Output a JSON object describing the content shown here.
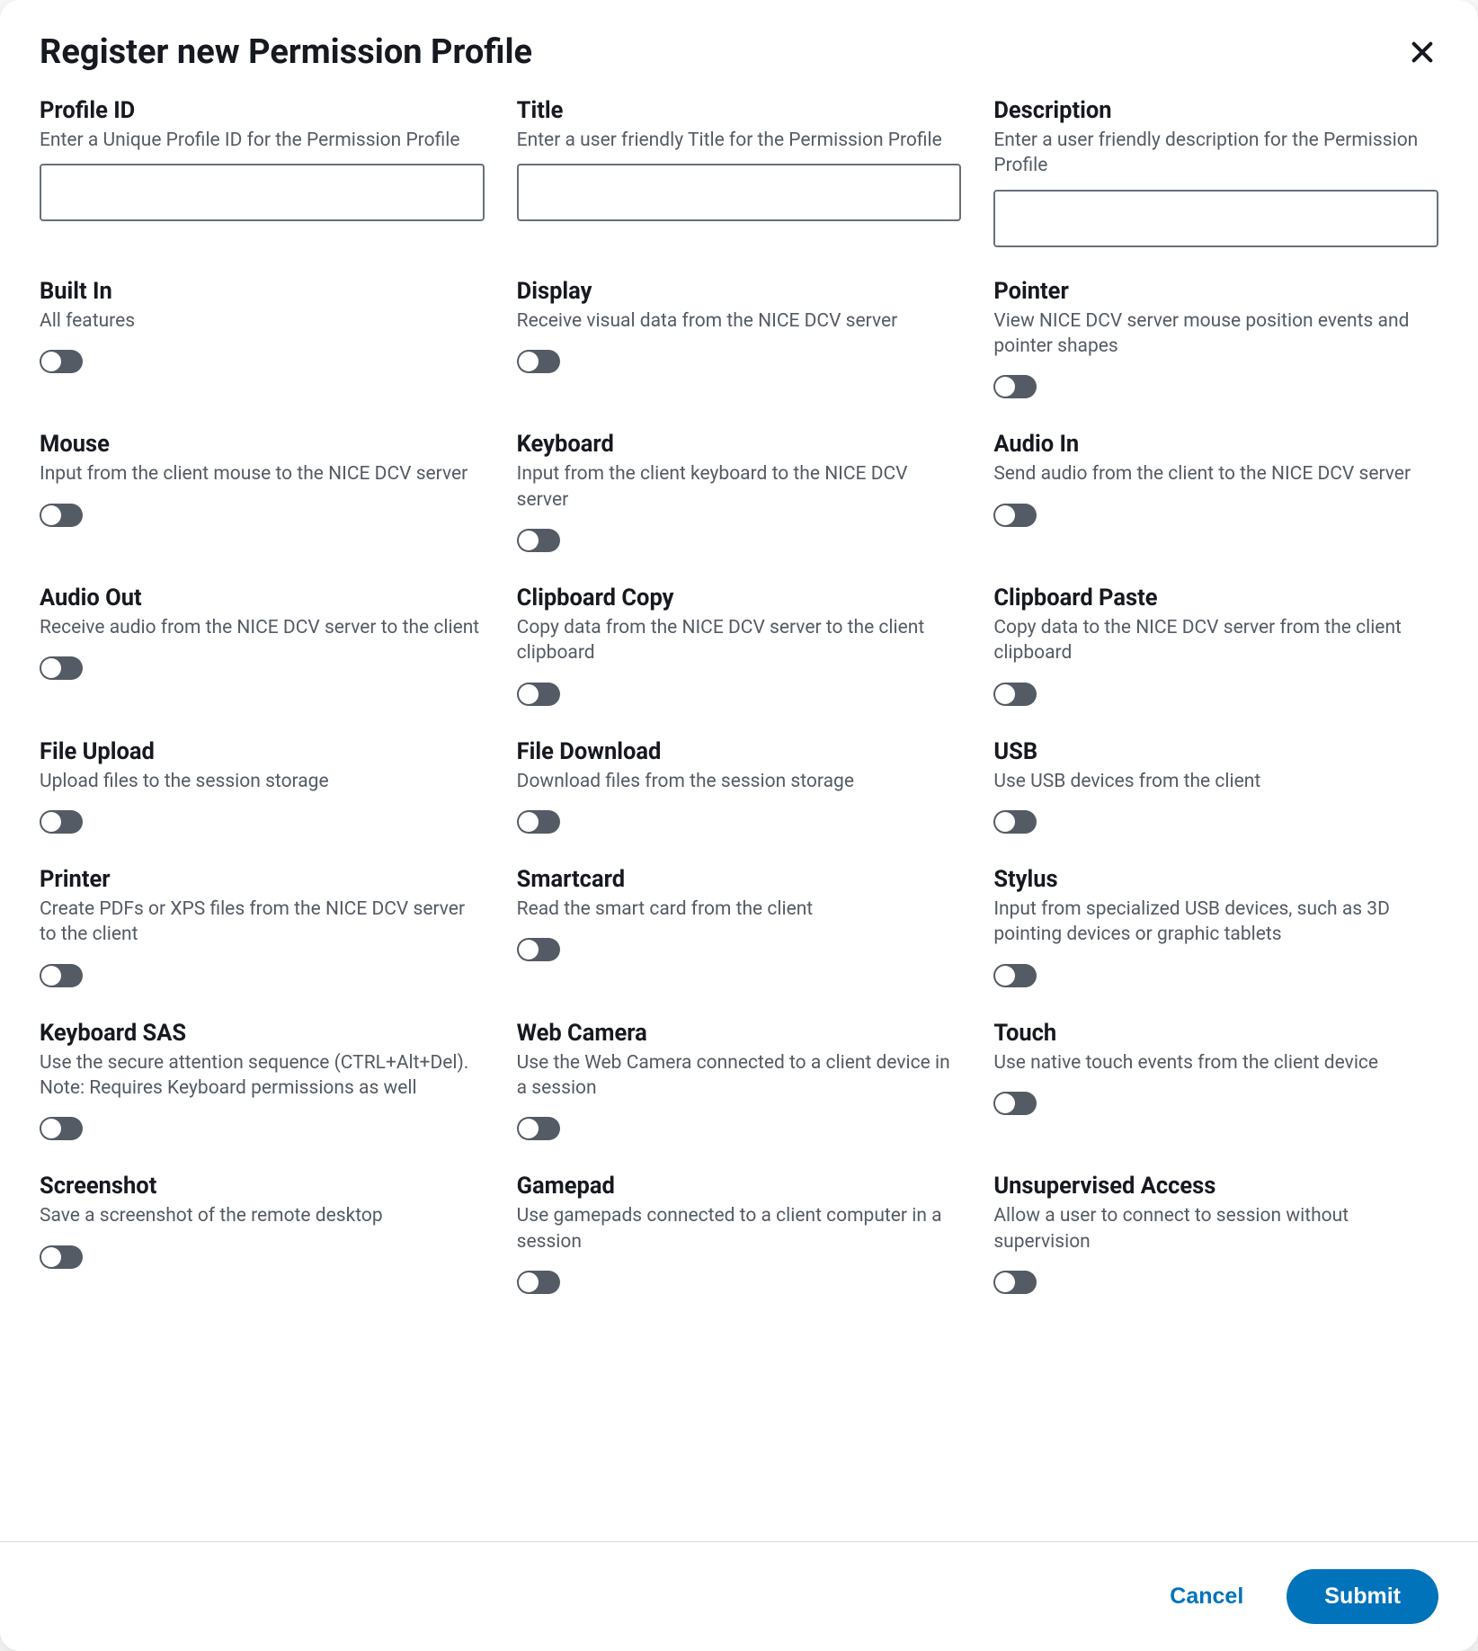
{
  "dialog": {
    "title": "Register new Permission Profile",
    "cancel_label": "Cancel",
    "submit_label": "Submit"
  },
  "text_fields": [
    {
      "key": "profile-id",
      "label": "Profile ID",
      "help": "Enter a Unique Profile ID for the Permission Profile",
      "value": ""
    },
    {
      "key": "title",
      "label": "Title",
      "help": "Enter a user friendly Title for the Permission Profile",
      "value": ""
    },
    {
      "key": "description",
      "label": "Description",
      "help": "Enter a user friendly description for the Permission Profile",
      "value": ""
    }
  ],
  "features": [
    {
      "key": "built-in",
      "label": "Built In",
      "help": "All features",
      "value": false
    },
    {
      "key": "display",
      "label": "Display",
      "help": "Receive visual data from the NICE DCV server",
      "value": false
    },
    {
      "key": "pointer",
      "label": "Pointer",
      "help": "View NICE DCV server mouse position events and pointer shapes",
      "value": false
    },
    {
      "key": "mouse",
      "label": "Mouse",
      "help": "Input from the client mouse to the NICE DCV server",
      "value": false
    },
    {
      "key": "keyboard",
      "label": "Keyboard",
      "help": "Input from the client keyboard to the NICE DCV server",
      "value": false
    },
    {
      "key": "audio-in",
      "label": "Audio In",
      "help": "Send audio from the client to the NICE DCV server",
      "value": false
    },
    {
      "key": "audio-out",
      "label": "Audio Out",
      "help": "Receive audio from the NICE DCV server to the client",
      "value": false
    },
    {
      "key": "clipboard-copy",
      "label": "Clipboard Copy",
      "help": "Copy data from the NICE DCV server to the client clipboard",
      "value": false
    },
    {
      "key": "clipboard-paste",
      "label": "Clipboard Paste",
      "help": "Copy data to the NICE DCV server from the client clipboard",
      "value": false
    },
    {
      "key": "file-upload",
      "label": "File Upload",
      "help": "Upload files to the session storage",
      "value": false
    },
    {
      "key": "file-download",
      "label": "File Download",
      "help": "Download files from the session storage",
      "value": false
    },
    {
      "key": "usb",
      "label": "USB",
      "help": "Use USB devices from the client",
      "value": false
    },
    {
      "key": "printer",
      "label": "Printer",
      "help": "Create PDFs or XPS files from the NICE DCV server to the client",
      "value": false
    },
    {
      "key": "smartcard",
      "label": "Smartcard",
      "help": "Read the smart card from the client",
      "value": false
    },
    {
      "key": "stylus",
      "label": "Stylus",
      "help": "Input from specialized USB devices, such as 3D pointing devices or graphic tablets",
      "value": false
    },
    {
      "key": "keyboard-sas",
      "label": "Keyboard SAS",
      "help": "Use the secure attention sequence (CTRL+Alt+Del). Note: Requires Keyboard permissions as well",
      "value": false
    },
    {
      "key": "web-camera",
      "label": "Web Camera",
      "help": "Use the Web Camera connected to a client device in a session",
      "value": false
    },
    {
      "key": "touch",
      "label": "Touch",
      "help": "Use native touch events from the client device",
      "value": false
    },
    {
      "key": "screenshot",
      "label": "Screenshot",
      "help": "Save a screenshot of the remote desktop",
      "value": false
    },
    {
      "key": "gamepad",
      "label": "Gamepad",
      "help": "Use gamepads connected to a client computer in a session",
      "value": false
    },
    {
      "key": "unsupervised-access",
      "label": "Unsupervised Access",
      "help": "Allow a user to connect to session without supervision",
      "value": false
    }
  ]
}
